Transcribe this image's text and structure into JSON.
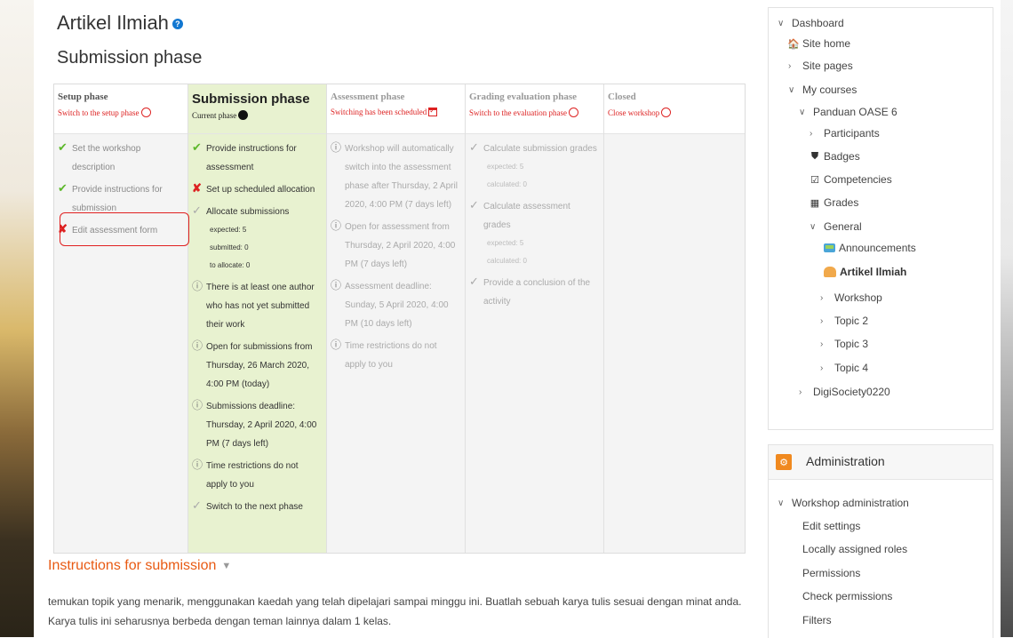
{
  "page": {
    "title": "Artikel Ilmiah",
    "subtitle": "Submission phase"
  },
  "phases": [
    {
      "name": "Setup phase",
      "action": "Switch to the setup phase",
      "tasks": [
        {
          "status": "done",
          "text": "Set the workshop description"
        },
        {
          "status": "done",
          "text": "Provide instructions for submission"
        },
        {
          "status": "fail",
          "text": "Edit assessment form"
        }
      ]
    },
    {
      "name": "Submission phase",
      "action": "Current phase",
      "tasks": [
        {
          "status": "done",
          "text": "Provide instructions for assessment"
        },
        {
          "status": "fail",
          "text": "Set up scheduled allocation"
        },
        {
          "status": "pending",
          "text": "Allocate submissions",
          "details": [
            "expected: 5",
            "submitted: 0",
            "to allocate: 0"
          ]
        },
        {
          "status": "info",
          "text": "There is at least one author who has not yet submitted their work"
        },
        {
          "status": "info",
          "text": "Open for submissions from Thursday, 26 March 2020, 4:00 PM (today)"
        },
        {
          "status": "info",
          "text": "Submissions deadline: Thursday, 2 April 2020, 4:00 PM (7 days left)"
        },
        {
          "status": "info",
          "text": "Time restrictions do not apply to you"
        },
        {
          "status": "pending",
          "text": "Switch to the next phase"
        }
      ]
    },
    {
      "name": "Assessment phase",
      "action": "Switching has been scheduled",
      "tasks": [
        {
          "status": "info",
          "text": "Workshop will automatically switch into the assessment phase after Thursday, 2 April 2020, 4:00 PM (7 days left)"
        },
        {
          "status": "info",
          "text": "Open for assessment from Thursday, 2 April 2020, 4:00 PM (7 days left)"
        },
        {
          "status": "info",
          "text": "Assessment deadline: Sunday, 5 April 2020, 4:00 PM (10 days left)"
        },
        {
          "status": "info",
          "text": "Time restrictions do not apply to you"
        }
      ]
    },
    {
      "name": "Grading evaluation phase",
      "action": "Switch to the evaluation phase",
      "tasks": [
        {
          "status": "pending",
          "text": "Calculate submission grades",
          "details": [
            "expected: 5",
            "calculated: 0"
          ]
        },
        {
          "status": "pending",
          "text": "Calculate assessment grades",
          "details": [
            "expected: 5",
            "calculated: 0"
          ]
        },
        {
          "status": "pending",
          "text": "Provide a conclusion of the activity"
        }
      ]
    },
    {
      "name": "Closed",
      "action": "Close workshop",
      "tasks": []
    }
  ],
  "instructions": {
    "heading": "Instructions for submission",
    "text": "temukan topik yang menarik, menggunakan kaedah yang telah dipelajari sampai minggu ini. Buatlah sebuah karya tulis sesuai dengan minat anda. Karya tulis ini seharusnya berbeda dengan teman lainnya dalam 1 kelas."
  },
  "navigation": {
    "dashboard": "Dashboard",
    "site_home": "Site home",
    "site_pages": "Site pages",
    "my_courses": "My courses",
    "course": "Panduan OASE 6",
    "participants": "Participants",
    "badges": "Badges",
    "competencies": "Competencies",
    "grades": "Grades",
    "general": "General",
    "announcements": "Announcements",
    "current": "Artikel Ilmiah",
    "workshop": "Workshop",
    "topic2": "Topic 2",
    "topic3": "Topic 3",
    "topic4": "Topic 4",
    "other_course": "DigiSociety0220"
  },
  "administration": {
    "title": "Administration",
    "section": "Workshop administration",
    "items": [
      "Edit settings",
      "Locally assigned roles",
      "Permissions",
      "Check permissions",
      "Filters"
    ]
  }
}
